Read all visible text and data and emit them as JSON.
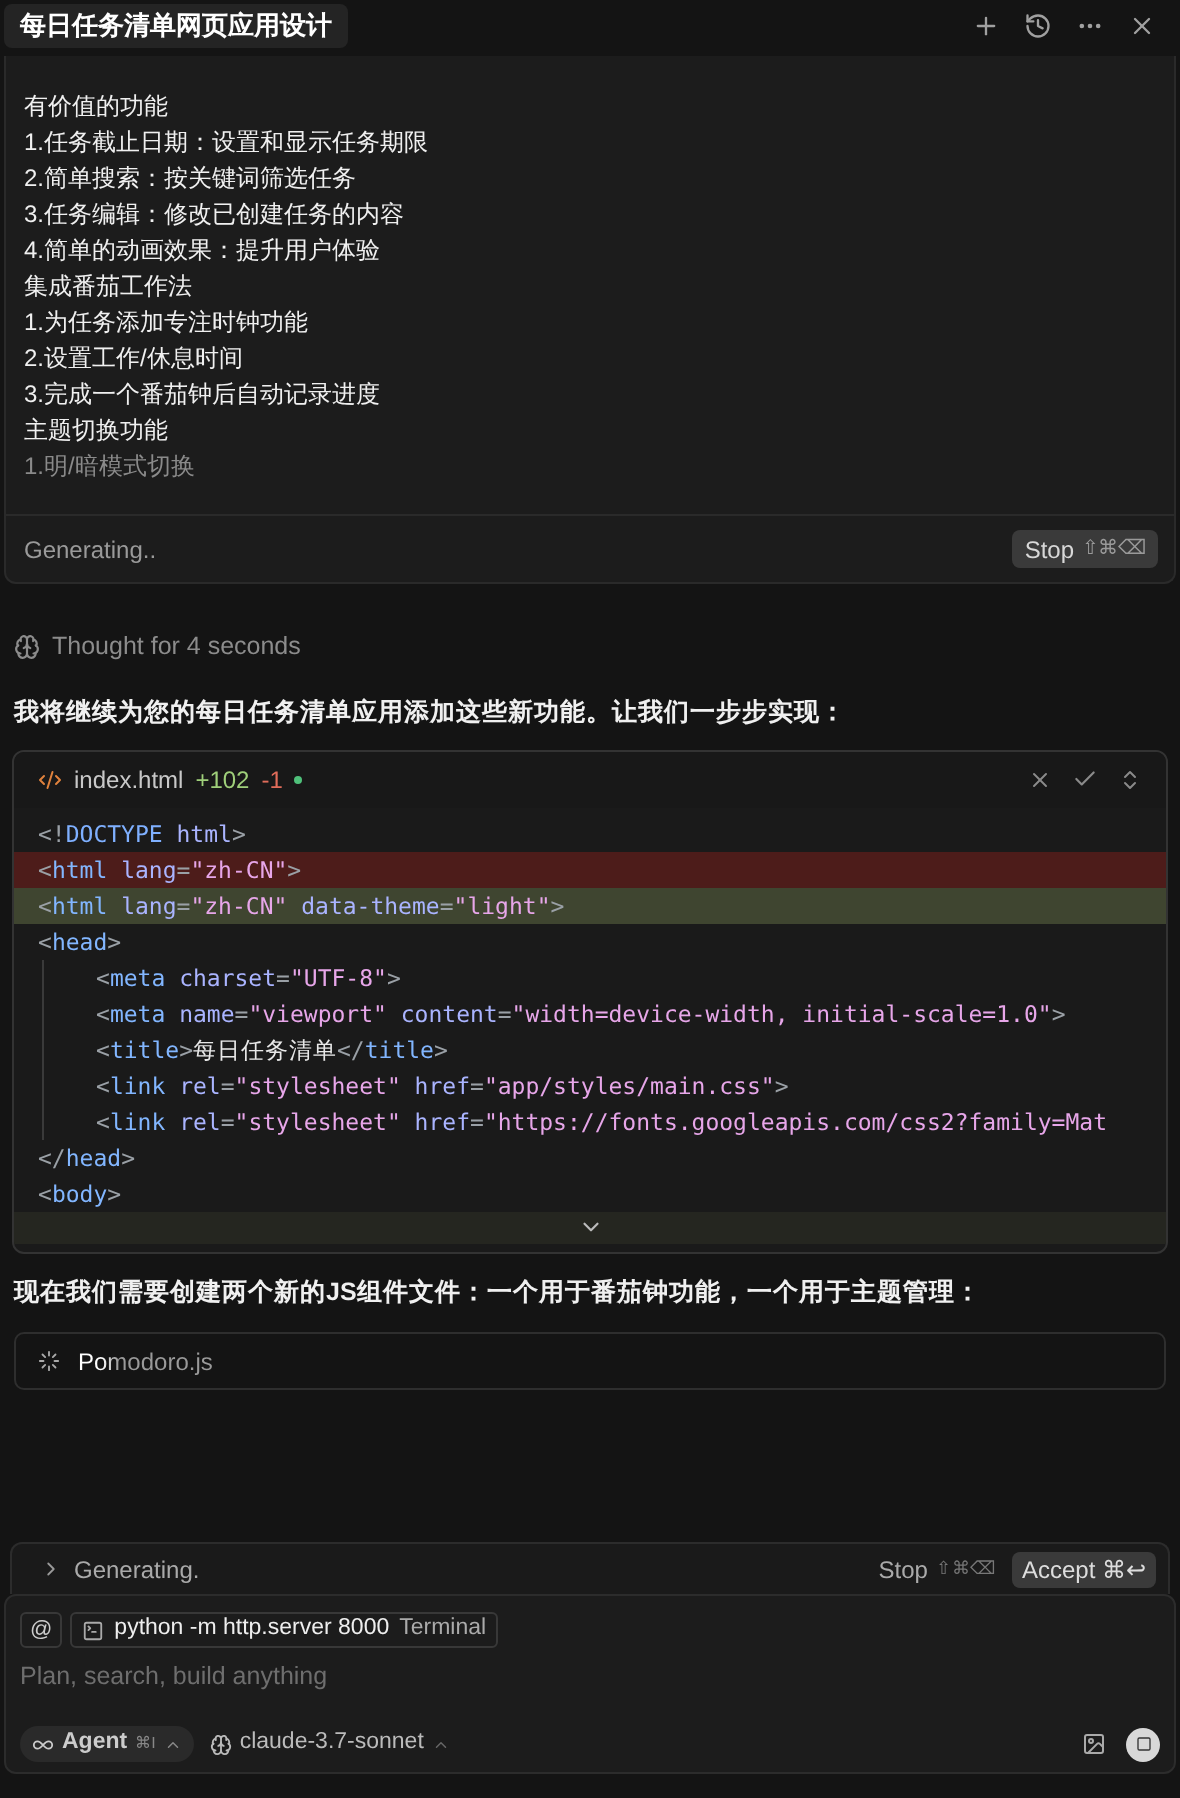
{
  "title_tab": "每日任务清单网页应用设计",
  "stream_card": {
    "lines": [
      {
        "text": "有价值的功能",
        "faded": false
      },
      {
        "text": "1.任务截止日期：设置和显示任务期限",
        "faded": false
      },
      {
        "text": "2.简单搜索：按关键词筛选任务",
        "faded": false
      },
      {
        "text": "3.任务编辑：修改已创建任务的内容",
        "faded": false
      },
      {
        "text": "4.简单的动画效果：提升用户体验",
        "faded": false
      },
      {
        "text": "集成番茄工作法",
        "faded": false
      },
      {
        "text": "1.为任务添加专注时钟功能",
        "faded": false
      },
      {
        "text": "2.设置工作/休息时间",
        "faded": false
      },
      {
        "text": "3.完成一个番茄钟后自动记录进度",
        "faded": false
      },
      {
        "text": "主题切换功能",
        "faded": false
      },
      {
        "text": "1.明/暗模式切换",
        "faded": true
      }
    ],
    "status": "Generating..",
    "stop_label": "Stop",
    "stop_keys": "⇧⌘⌫"
  },
  "thought": "Thought for 4 seconds",
  "intro": "我将继续为您的每日任务清单应用添加这些新功能。让我们一步步实现：",
  "code_block": {
    "file": "index.html",
    "added": "+102",
    "removed": "-1",
    "lines": [
      {
        "tokens": [
          {
            "t": "<!",
            "kind": "punct"
          },
          {
            "t": "DOCTYPE",
            "kind": "keyword"
          },
          {
            "t": " html",
            "kind": "attr"
          },
          {
            "t": ">",
            "kind": "punct"
          }
        ]
      },
      {
        "kind": "removed",
        "tokens": [
          {
            "t": "<",
            "kind": "punct"
          },
          {
            "t": "html",
            "kind": "tag"
          },
          {
            "t": " lang",
            "kind": "attr"
          },
          {
            "t": "=",
            "kind": "punct"
          },
          {
            "t": "\"zh-CN\"",
            "kind": "string"
          },
          {
            "t": ">",
            "kind": "punct"
          }
        ]
      },
      {
        "kind": "added",
        "tokens": [
          {
            "t": "<",
            "kind": "punct"
          },
          {
            "t": "html",
            "kind": "tag"
          },
          {
            "t": " lang",
            "kind": "attr"
          },
          {
            "t": "=",
            "kind": "punct"
          },
          {
            "t": "\"zh-CN\"",
            "kind": "string"
          },
          {
            "t": " data-theme",
            "kind": "attr"
          },
          {
            "t": "=",
            "kind": "punct"
          },
          {
            "t": "\"light\"",
            "kind": "string"
          },
          {
            "t": ">",
            "kind": "punct"
          }
        ]
      },
      {
        "tokens": [
          {
            "t": "<",
            "kind": "punct"
          },
          {
            "t": "head",
            "kind": "tag"
          },
          {
            "t": ">",
            "kind": "punct"
          }
        ],
        "children": [
          {
            "tokens": [
              {
                "t": "<",
                "kind": "punct"
              },
              {
                "t": "meta",
                "kind": "tag"
              },
              {
                "t": " charset",
                "kind": "attr"
              },
              {
                "t": "=",
                "kind": "punct"
              },
              {
                "t": "\"UTF-8\"",
                "kind": "string"
              },
              {
                "t": ">",
                "kind": "punct"
              }
            ]
          },
          {
            "tokens": [
              {
                "t": "<",
                "kind": "punct"
              },
              {
                "t": "meta",
                "kind": "tag"
              },
              {
                "t": " name",
                "kind": "attr"
              },
              {
                "t": "=",
                "kind": "punct"
              },
              {
                "t": "\"viewport\"",
                "kind": "string"
              },
              {
                "t": " content",
                "kind": "attr"
              },
              {
                "t": "=",
                "kind": "punct"
              },
              {
                "t": "\"width=device-width, initial-scale=1.0\"",
                "kind": "string"
              },
              {
                "t": ">",
                "kind": "punct"
              }
            ]
          },
          {
            "tokens": [
              {
                "t": "<",
                "kind": "punct"
              },
              {
                "t": "title",
                "kind": "tag"
              },
              {
                "t": ">",
                "kind": "punct"
              },
              {
                "t": "每日任务清单",
                "kind": "text"
              },
              {
                "t": "</",
                "kind": "punct"
              },
              {
                "t": "title",
                "kind": "tag"
              },
              {
                "t": ">",
                "kind": "punct"
              }
            ]
          },
          {
            "tokens": [
              {
                "t": "<",
                "kind": "punct"
              },
              {
                "t": "link",
                "kind": "tag"
              },
              {
                "t": " rel",
                "kind": "attr"
              },
              {
                "t": "=",
                "kind": "punct"
              },
              {
                "t": "\"stylesheet\"",
                "kind": "string"
              },
              {
                "t": " href",
                "kind": "attr"
              },
              {
                "t": "=",
                "kind": "punct"
              },
              {
                "t": "\"app/styles/main.css\"",
                "kind": "string"
              },
              {
                "t": ">",
                "kind": "punct"
              }
            ]
          },
          {
            "tokens": [
              {
                "t": "<",
                "kind": "punct"
              },
              {
                "t": "link",
                "kind": "tag"
              },
              {
                "t": " rel",
                "kind": "attr"
              },
              {
                "t": "=",
                "kind": "punct"
              },
              {
                "t": "\"stylesheet\"",
                "kind": "string"
              },
              {
                "t": " href",
                "kind": "attr"
              },
              {
                "t": "=",
                "kind": "punct"
              },
              {
                "t": "\"https://fonts.googleapis.com/css2?family=Mat",
                "kind": "string"
              }
            ]
          }
        ]
      },
      {
        "tokens": [
          {
            "t": "</",
            "kind": "punct"
          },
          {
            "t": "head",
            "kind": "tag"
          },
          {
            "t": ">",
            "kind": "punct"
          }
        ]
      },
      {
        "tokens": [
          {
            "t": "<",
            "kind": "punct"
          },
          {
            "t": "body",
            "kind": "tag"
          },
          {
            "t": ">",
            "kind": "punct"
          }
        ]
      }
    ]
  },
  "outro": "现在我们需要创建两个新的JS组件文件：一个用于番茄钟功能，一个用于主题管理：",
  "pending_file": {
    "name": "Pomodoro.js"
  },
  "generation_bar": {
    "status": "Generating.",
    "stop_label": "Stop",
    "stop_keys": "⇧⌘⌫",
    "accept_label": "Accept ⌘↩"
  },
  "composer": {
    "mention": "@",
    "context_chip": {
      "command": "python -m http.server 8000",
      "kind": "Terminal"
    },
    "placeholder": "Plan, search, build anything",
    "mode": "Agent",
    "mode_keys": "⌘I",
    "model": "claude-3.7-sonnet"
  }
}
